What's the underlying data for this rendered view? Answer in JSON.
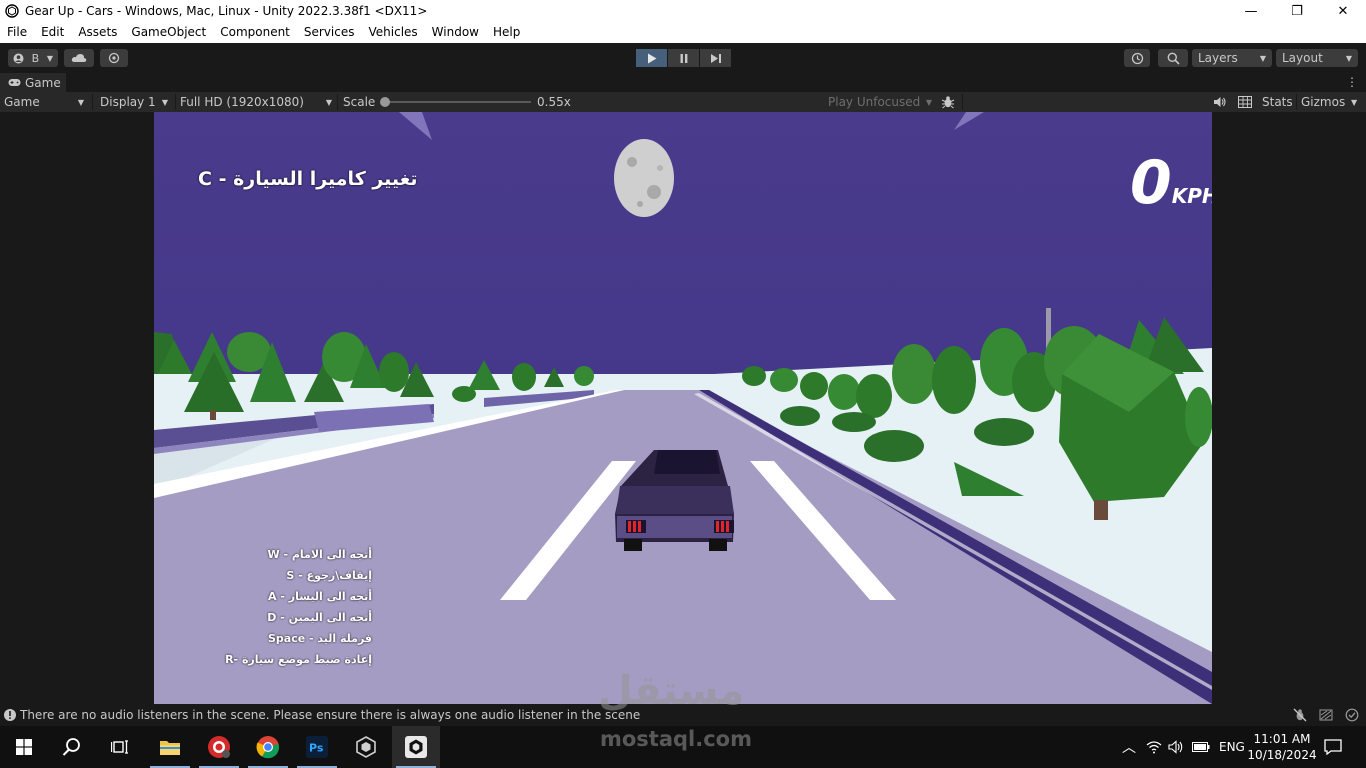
{
  "window": {
    "title": "Gear Up - Cars - Windows, Mac, Linux - Unity 2022.3.38f1 <DX11>",
    "minimize_glyph": "—",
    "maximize_glyph": "❐",
    "close_glyph": "✕"
  },
  "menu": [
    "File",
    "Edit",
    "Assets",
    "GameObject",
    "Component",
    "Services",
    "Vehicles",
    "Window",
    "Help"
  ],
  "toolbar": {
    "account_label": "B",
    "layers_label": "Layers",
    "layout_label": "Layout"
  },
  "tab": {
    "label": "Game"
  },
  "game_toolbar": {
    "mode": "Game",
    "display": "Display 1",
    "resolution": "Full HD (1920x1080)",
    "scale_label": "Scale",
    "scale_value": "0.55x",
    "scale_fraction": 0.0,
    "play_focus": "Play Unfocused",
    "stats": "Stats",
    "gizmos": "Gizmos"
  },
  "game": {
    "camera_hint": "تغيير كاميرا السيارة - C",
    "speed_value": "0",
    "speed_unit": "KPH",
    "controls": [
      "أتجه الى الامام - W",
      "إيقاف\\رجوع - S",
      "أتجه الى اليسار - A",
      "أتجه الى اليمين - D",
      "فرملة اليد - Space",
      "إعادة ضبط موضع سيارة -R"
    ],
    "colors": {
      "sky": "#4a3b8c",
      "road": "#a49cc2",
      "snow": "#e6f1f5",
      "tree": "#2d7a2b"
    }
  },
  "status": {
    "message": "There are no audio listeners in the scene. Please ensure there is always one audio listener in the scene"
  },
  "watermark": {
    "arabic": "مستقل",
    "latin": "mostaql.com"
  },
  "taskbar": {
    "language": "ENG",
    "time": "11:01 AM",
    "date": "10/18/2024"
  }
}
